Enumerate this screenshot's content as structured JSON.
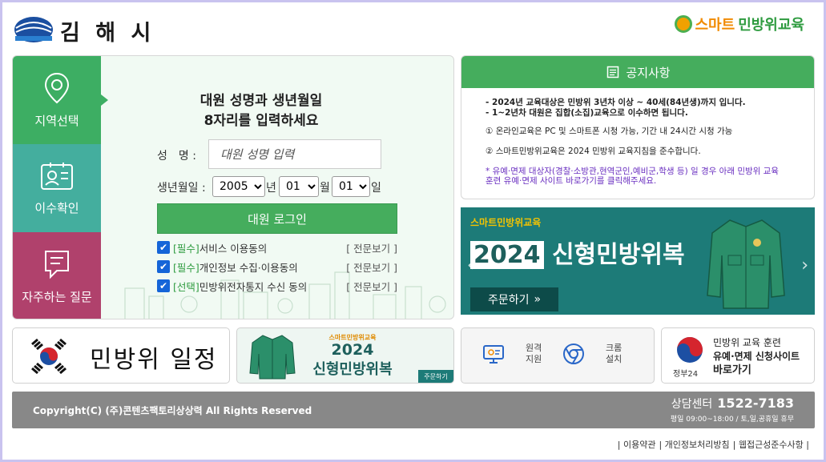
{
  "header": {
    "city_name": "김 해 시",
    "program_logo_part1": "스마트",
    "program_logo_part2": "민방위교육"
  },
  "tabs": [
    {
      "label": "지역선택",
      "icon": "map-pin-icon"
    },
    {
      "label": "이수확인",
      "icon": "id-card-icon"
    },
    {
      "label": "자주하는 질문",
      "icon": "chat-bubble-icon"
    }
  ],
  "login": {
    "title_line1": "대원 성명과 생년월일",
    "title_line2": "8자리를 입력하세요",
    "name_label": "성　명 :",
    "name_placeholder": "대원 성명 입력",
    "birth_label": "생년월일 :",
    "year_value": "2005",
    "year_unit": "년",
    "month_value": "01",
    "month_unit": "월",
    "day_value": "01",
    "day_unit": "일",
    "login_button": "대원 로그인",
    "agreements": [
      {
        "tag": "[필수]",
        "text": "서비스 이용동의",
        "more": "[ 전문보기 ]",
        "checked": true
      },
      {
        "tag": "[필수]",
        "text": "개인정보 수집·이용동의",
        "more": "[ 전문보기 ]",
        "checked": true
      },
      {
        "tag": "[선택]",
        "text": "민방위전자통지 수신 동의",
        "more": "[ 전문보기 ]",
        "checked": true
      }
    ]
  },
  "notice": {
    "title": "공지사항",
    "lines": [
      "- 2024년 교육대상은 민방위 3년차 이상 ~ 40세(84년생)까지 입니다.",
      "- 1~2년차 대원은 집합(소집)교육으로 이수하면 됩니다.",
      "① 온라인교육은 PC 및 스마트폰 시청 가능, 기간 내 24시간 시청 가능",
      "② 스마트민방위교육은 2024 민방위 교육지침을 준수합니다.",
      "* 유예·면제 대상자(경찰·소방관,현역군인,예비군,학생 등) 일 경우 아래 민방위 교육",
      "훈련 유예·면제 사이트 바로가기를 클릭해주세요."
    ]
  },
  "banner": {
    "tag": "스마트민방위교육",
    "year": "2024",
    "title": "신형민방위복",
    "order_button": "주문하기"
  },
  "quick_links": {
    "schedule": "민방위 일정",
    "uniform_tag": "스마트민방위교육",
    "uniform_year": "2024",
    "uniform_title": "신형민방위복",
    "uniform_order": "주문하기",
    "remote_support_line1": "원격",
    "remote_support_line2": "지원",
    "chrome_install_line1": "크롬",
    "chrome_install_line2": "설치",
    "gov_line1": "민방위 교육 훈련",
    "gov_line2": "유예·면제 신청사이트",
    "gov_line3": "바로가기",
    "gov_brand": "정부24"
  },
  "footer": {
    "copyright": "Copyright(C) (주)콘텐츠팩토리상상력 All Rights Reserved",
    "center_label": "상담센터",
    "center_phone": "1522-7183",
    "center_hours": "평일 09:00~18:00 / 토,일,공휴일 휴무"
  },
  "links": [
    "| 이용약관",
    "| 개인정보처리방침",
    "| 웹접근성준수사항 |"
  ],
  "colors": {
    "primary_green": "#45ad5d",
    "teal": "#44ae9e",
    "magenta": "#b0416c",
    "footer_gray": "#888888",
    "banner_teal": "#1d7b78"
  }
}
